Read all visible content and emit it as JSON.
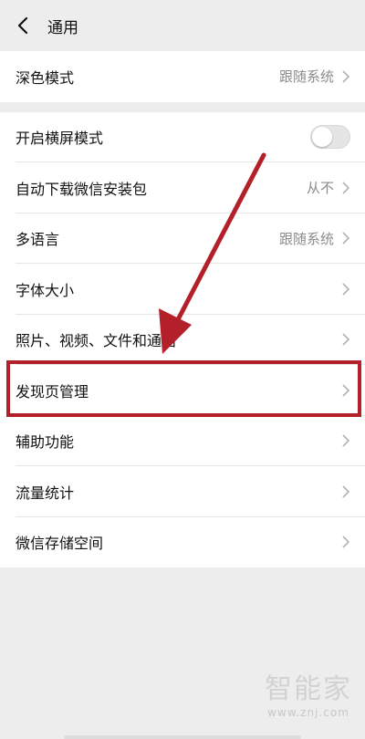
{
  "header": {
    "title": "通用",
    "back_icon": "chevron-left-icon"
  },
  "group1": {
    "dark_mode": {
      "label": "深色模式",
      "value": "跟随系统"
    }
  },
  "group2": {
    "landscape": {
      "label": "开启横屏模式",
      "toggle_on": false
    },
    "auto_download": {
      "label": "自动下载微信安装包",
      "value": "从不"
    },
    "language": {
      "label": "多语言",
      "value": "跟随系统"
    },
    "font_size": {
      "label": "字体大小"
    },
    "media": {
      "label": "照片、视频、文件和通话"
    },
    "discover": {
      "label": "发现页管理"
    },
    "accessibility": {
      "label": "辅助功能"
    },
    "data_usage": {
      "label": "流量统计"
    },
    "storage": {
      "label": "微信存储空间"
    }
  },
  "colors": {
    "background": "#ededed",
    "annotation_red": "#b3202a",
    "chevron": "#b2b2b2"
  },
  "watermark": {
    "logo": "智能家",
    "url": "www.znj.com"
  }
}
